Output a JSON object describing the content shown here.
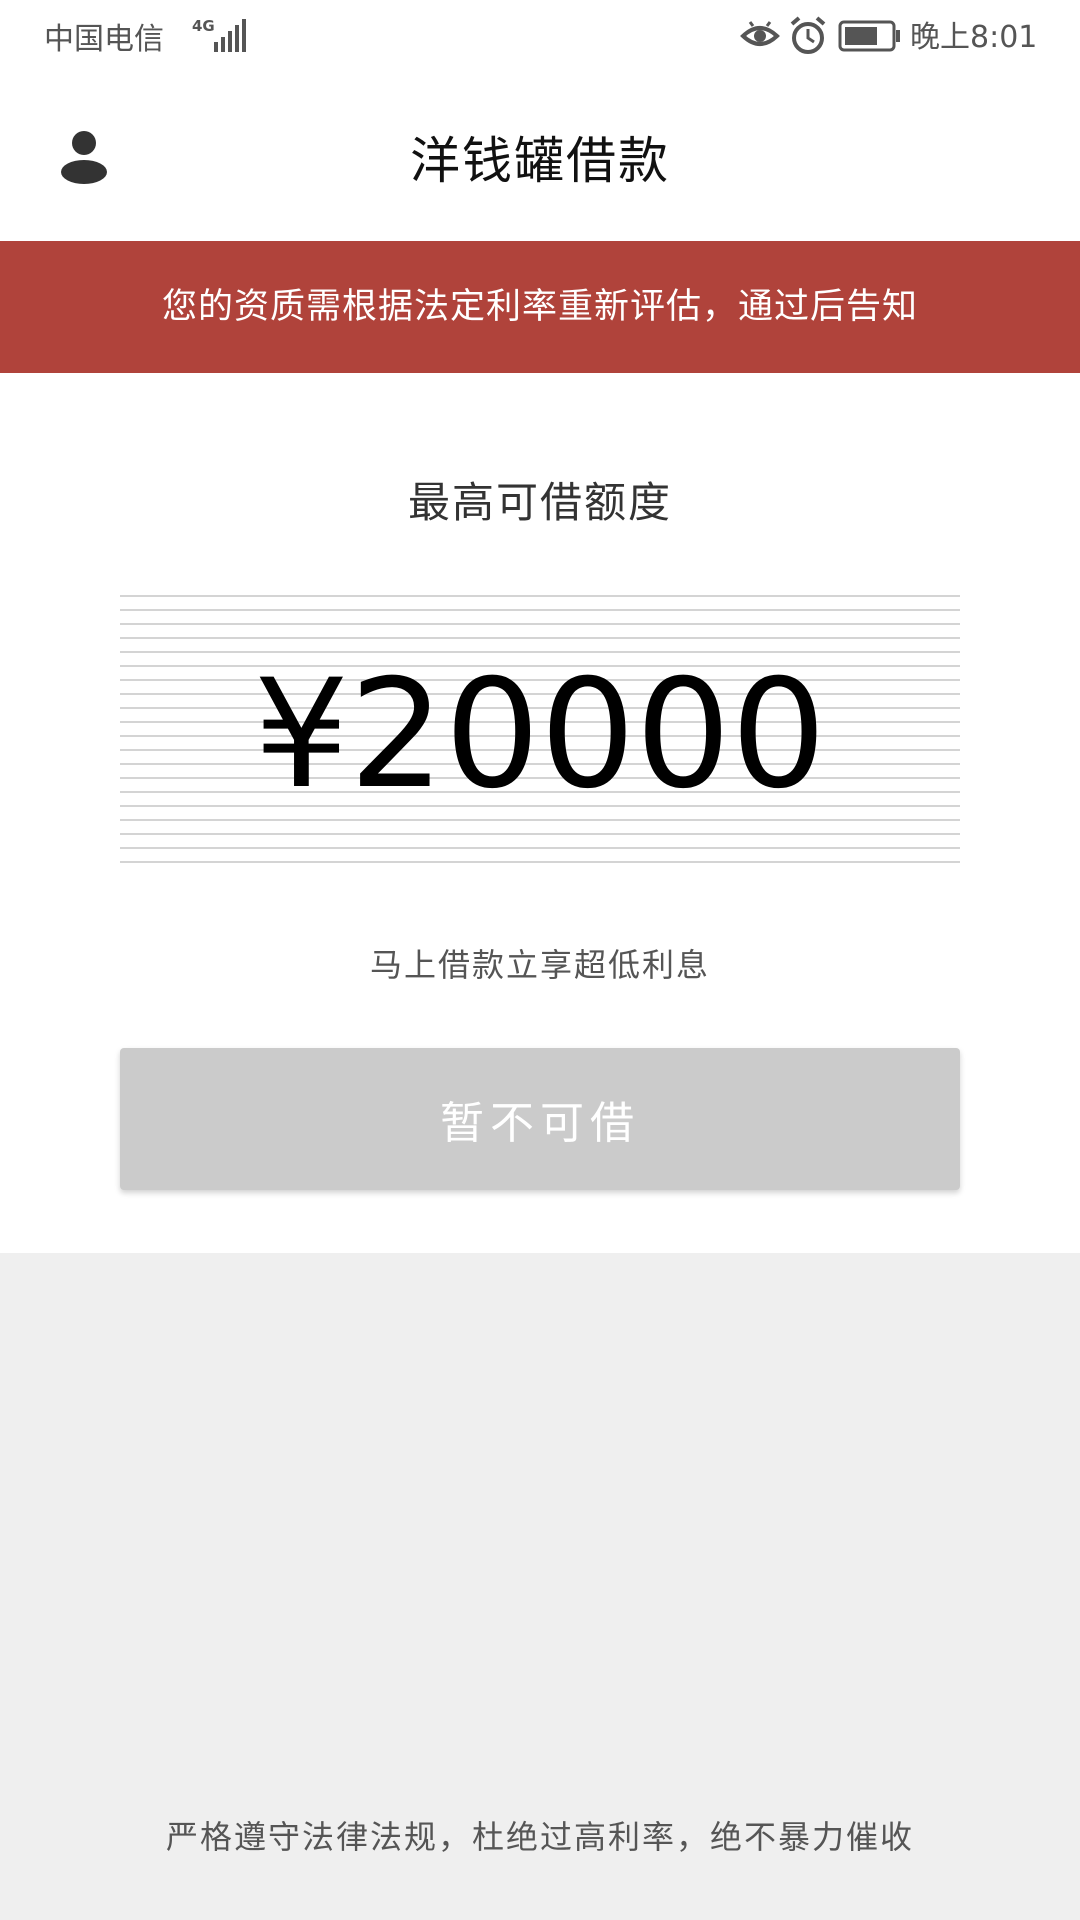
{
  "status_bar": {
    "carrier": "中国电信",
    "network_type": "4G",
    "time": "晚上8:01",
    "icons": [
      "signal-icon",
      "eye-icon",
      "alarm-icon",
      "battery-icon"
    ]
  },
  "header": {
    "title": "洋钱罐借款",
    "profile_icon": "user-avatar-icon"
  },
  "notice": {
    "text": "您的资质需根据法定利率重新评估，通过后告知"
  },
  "main": {
    "limit_label": "最高可借额度",
    "amount": "¥20000",
    "promo": "马上借款立享超低利息",
    "button_label": "暂不可借"
  },
  "footer": {
    "text": "严格遵守法律法规，杜绝过高利率，绝不暴力催收"
  },
  "colors": {
    "banner": "#b0433b",
    "button_disabled": "#cbcbcb",
    "background": "#efefef"
  }
}
